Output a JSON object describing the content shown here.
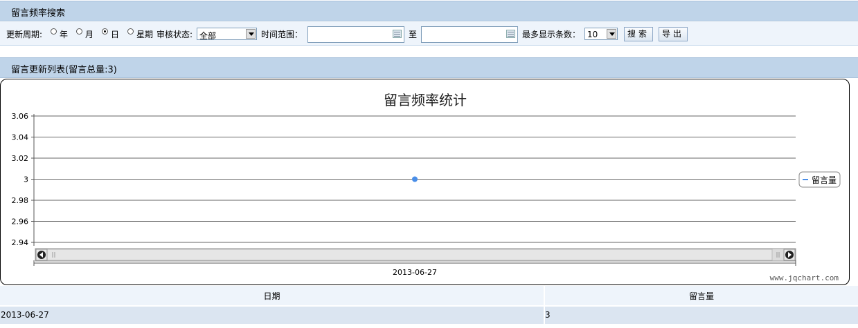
{
  "search_header": {
    "title": "留言频率搜索"
  },
  "toolbar": {
    "period_label": "更新周期:",
    "options": [
      "年",
      "月",
      "日",
      "星期"
    ],
    "selected_period": "日",
    "review_label": "审核状态:",
    "review_value": "全部",
    "time_range_label": "时间范围：",
    "to_label": "至",
    "start_date": "",
    "end_date": "",
    "max_rows_label": "最多显示条数：",
    "max_rows_value": "10",
    "search_button": "搜索",
    "export_button": "导出"
  },
  "list_header": {
    "title": "留言更新列表(留言总量:3)"
  },
  "chart_data": {
    "type": "line",
    "title": "留言频率统计",
    "categories": [
      "2013-06-27"
    ],
    "series": [
      {
        "name": "留言量",
        "values": [
          3
        ],
        "color": "#4a8ee8"
      }
    ],
    "ylim": [
      2.94,
      3.06
    ],
    "yticks": [
      "3.06",
      "3.04",
      "3.02",
      "3",
      "2.98",
      "2.96",
      "2.94"
    ],
    "grid": true,
    "legend": "right",
    "watermark": "www.jqchart.com"
  },
  "table": {
    "columns": [
      "日期",
      "留言量"
    ],
    "rows": [
      [
        "2013-06-27",
        "3"
      ]
    ]
  }
}
